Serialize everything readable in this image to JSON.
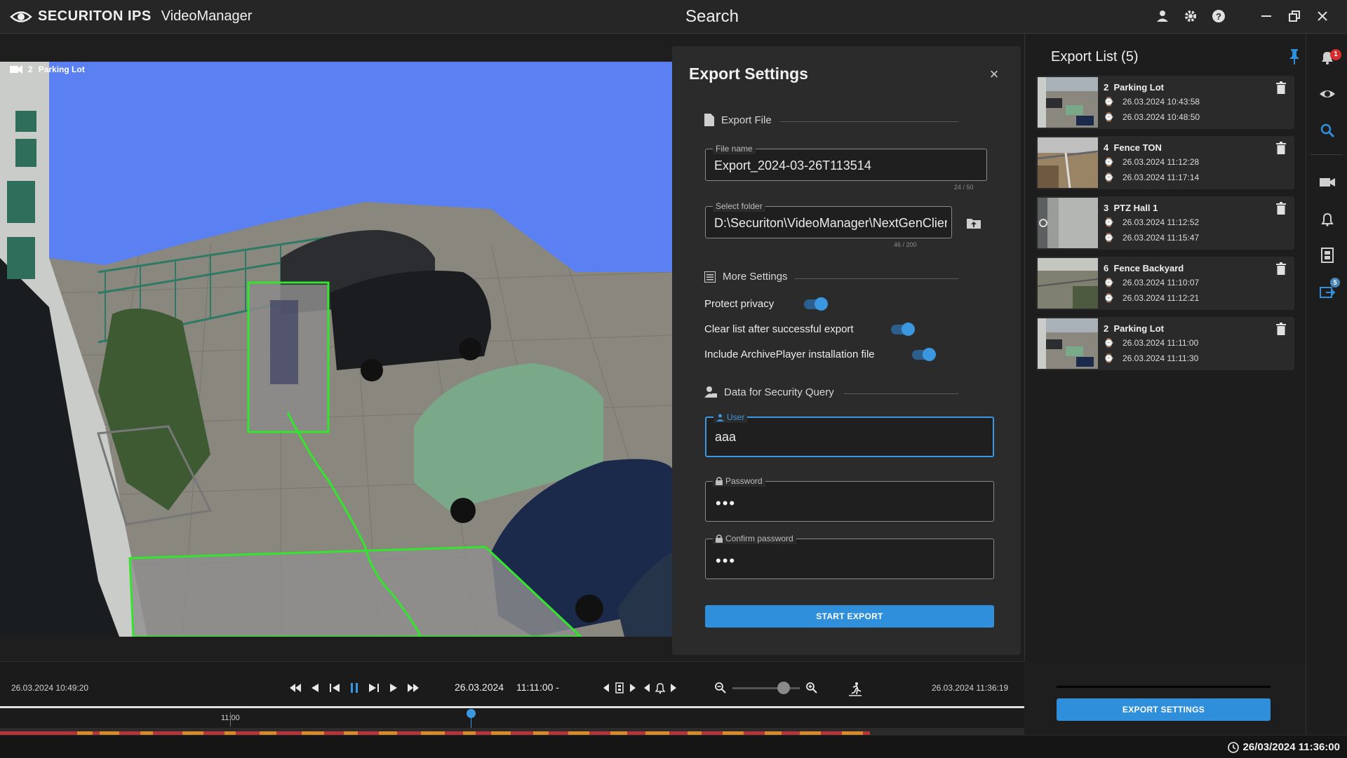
{
  "app": {
    "brand_name": "SECURITON IPS",
    "brand_product": "VideoManager",
    "page_title": "Search"
  },
  "video": {
    "camera_number": "2",
    "camera_name": "Parking Lot"
  },
  "export_settings": {
    "title": "Export Settings",
    "export_file_heading": "Export File",
    "file_name_label": "File name",
    "file_name_value": "Export_2024-03-26T113514",
    "file_name_counter": "24 / 50",
    "folder_label": "Select folder",
    "folder_value": "D:\\Securiton\\VideoManager\\NextGenClier",
    "folder_counter": "46 / 200",
    "more_settings_heading": "More Settings",
    "toggles": [
      {
        "label": "Protect privacy",
        "on": true
      },
      {
        "label": "Clear list after successful export",
        "on": true
      },
      {
        "label": "Include ArchivePlayer installation file",
        "on": true
      }
    ],
    "security_heading": "Data for Security Query",
    "user_label": "User",
    "user_value": "aaa",
    "password_label": "Password",
    "password_value": "•••",
    "confirm_label": "Confirm password",
    "confirm_value": "•••",
    "start_button": "START EXPORT"
  },
  "export_list": {
    "title": "Export List (5)",
    "items": [
      {
        "cam": "2",
        "name": "Parking Lot",
        "start": "26.03.2024 10:43:58",
        "end": "26.03.2024 10:48:50"
      },
      {
        "cam": "4",
        "name": "Fence TON",
        "start": "26.03.2024 11:12:28",
        "end": "26.03.2024 11:17:14"
      },
      {
        "cam": "3",
        "name": "PTZ Hall 1",
        "start": "26.03.2024 11:12:52",
        "end": "26.03.2024 11:15:47"
      },
      {
        "cam": "6",
        "name": "Fence Backyard",
        "start": "26.03.2024 11:10:07",
        "end": "26.03.2024 11:12:21"
      },
      {
        "cam": "2",
        "name": "Parking Lot",
        "start": "26.03.2024 11:11:00",
        "end": "26.03.2024 11:11:30"
      }
    ],
    "export_settings_button": "EXPORT SETTINGS"
  },
  "rail": {
    "notification_badge": "1",
    "export_badge": "5"
  },
  "player": {
    "range_start": "26.03.2024 10:49:20",
    "range_end": "26.03.2024 11:36:19",
    "current_date": "26.03.2024",
    "current_time": "11:11:00 -",
    "timeline_tick": "11:00"
  },
  "status": {
    "clock": "26/03/2024 11:36:00"
  },
  "colors": {
    "accent": "#2f8fdb",
    "zone": "#34e52e",
    "sky_mask": "#5b80f2"
  }
}
